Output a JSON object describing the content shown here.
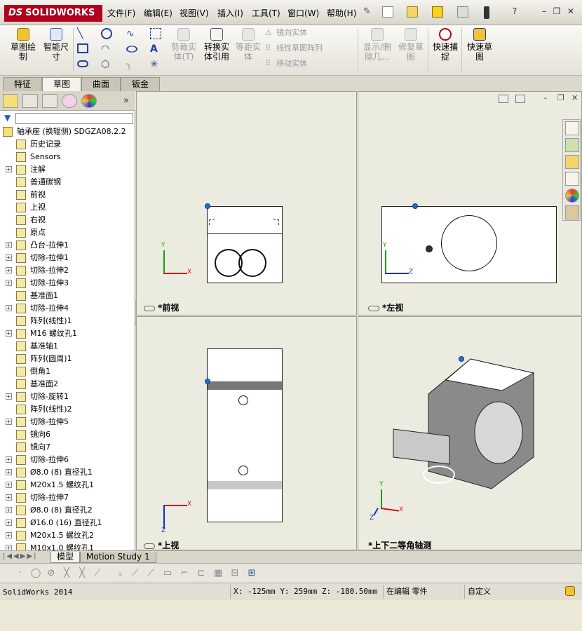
{
  "app": {
    "logo_ds": "DS",
    "logo_name": "SOLIDWORKS"
  },
  "menu": [
    "文件(F)",
    "编辑(E)",
    "视图(V)",
    "插入(I)",
    "工具(T)",
    "窗口(W)",
    "帮助(H)"
  ],
  "commands": {
    "sketch": "草图绘\n制",
    "smart_dim": "智能尺\n寸",
    "trim": "剪裁实\n体(T)",
    "convert": "转换实\n体引用",
    "offset": "等距实\n体",
    "mirror": "镜向实体",
    "linear_pattern": "线性草图阵列",
    "move": "移动实体",
    "show_delete": "显示/删\n除几…",
    "repair": "修复草\n图",
    "quick_snap": "快速捕\n捉",
    "rapid_sketch": "快速草\n图"
  },
  "tabs": [
    "特征",
    "草图",
    "曲面",
    "钣金"
  ],
  "active_tab": "草图",
  "tree": {
    "root": "轴承座 (换辊侧)  SDGZA08.2.2",
    "items": [
      {
        "label": "历史记录",
        "icon": "history-icon",
        "exp": false
      },
      {
        "label": "Sensors",
        "icon": "sensor-icon",
        "exp": false
      },
      {
        "label": "注解",
        "icon": "annotation-icon",
        "exp": true
      },
      {
        "label": "普通碳钢",
        "icon": "material-icon",
        "exp": false
      },
      {
        "label": "前视",
        "icon": "plane-icon",
        "exp": false
      },
      {
        "label": "上视",
        "icon": "plane-icon",
        "exp": false
      },
      {
        "label": "右视",
        "icon": "plane-icon",
        "exp": false
      },
      {
        "label": "原点",
        "icon": "origin-icon",
        "exp": false
      },
      {
        "label": "凸台-拉伸1",
        "icon": "boss-icon",
        "exp": true
      },
      {
        "label": "切除-拉伸1",
        "icon": "cut-icon",
        "exp": true
      },
      {
        "label": "切除-拉伸2",
        "icon": "cut-icon",
        "exp": true
      },
      {
        "label": "切除-拉伸3",
        "icon": "cut-icon",
        "exp": true
      },
      {
        "label": "基准面1",
        "icon": "plane-icon",
        "exp": false
      },
      {
        "label": "切除-拉伸4",
        "icon": "cut-icon",
        "exp": true
      },
      {
        "label": "阵列(线性)1",
        "icon": "pattern-icon",
        "exp": false
      },
      {
        "label": "M16 螺纹孔1",
        "icon": "hole-icon",
        "exp": true
      },
      {
        "label": "基准轴1",
        "icon": "axis-icon",
        "exp": false
      },
      {
        "label": "阵列(圆周)1",
        "icon": "circular-pattern-icon",
        "exp": false
      },
      {
        "label": "倒角1",
        "icon": "chamfer-icon",
        "exp": false
      },
      {
        "label": "基准面2",
        "icon": "plane-icon",
        "exp": false
      },
      {
        "label": "切除-旋转1",
        "icon": "revolve-cut-icon",
        "exp": true
      },
      {
        "label": "阵列(线性)2",
        "icon": "pattern-icon",
        "exp": false
      },
      {
        "label": "切除-拉伸5",
        "icon": "cut-icon",
        "exp": true
      },
      {
        "label": "镜向6",
        "icon": "mirror-icon",
        "exp": false
      },
      {
        "label": "镜向7",
        "icon": "mirror-icon",
        "exp": false
      },
      {
        "label": "切除-拉伸6",
        "icon": "cut-icon",
        "exp": true
      },
      {
        "label": "Ø8.0 (8) 直径孔1",
        "icon": "hole-icon",
        "exp": true
      },
      {
        "label": "M20x1.5 螺纹孔1",
        "icon": "hole-icon",
        "exp": true
      },
      {
        "label": "切除-拉伸7",
        "icon": "cut-icon",
        "exp": true
      },
      {
        "label": "Ø8.0 (8) 直径孔2",
        "icon": "hole-icon",
        "exp": true
      },
      {
        "label": "Ø16.0 (16) 直径孔1",
        "icon": "hole-icon",
        "exp": true
      },
      {
        "label": "M20x1.5 螺纹孔2",
        "icon": "hole-icon",
        "exp": true
      },
      {
        "label": "M10x1.0 螺纹孔1",
        "icon": "hole-icon",
        "exp": true
      }
    ]
  },
  "views": {
    "front": "*前视",
    "left": "*左视",
    "top": "*上视",
    "iso": "*上下二等角轴测"
  },
  "axes": {
    "x": "X",
    "y": "Y",
    "z": "Z"
  },
  "bottom_tabs": [
    "模型",
    "Motion Study 1"
  ],
  "status": {
    "app": "SolidWorks 2014",
    "coords": "X: -125mm Y: 259mm Z: -180.50mm",
    "mode": "在编辑 零件",
    "units": "自定义"
  },
  "colors": {
    "accent": "#b2001e",
    "origin_blue": "#1f6fd8",
    "axis_x": "#d01010",
    "axis_y": "#14a014",
    "axis_z": "#1030d0"
  }
}
